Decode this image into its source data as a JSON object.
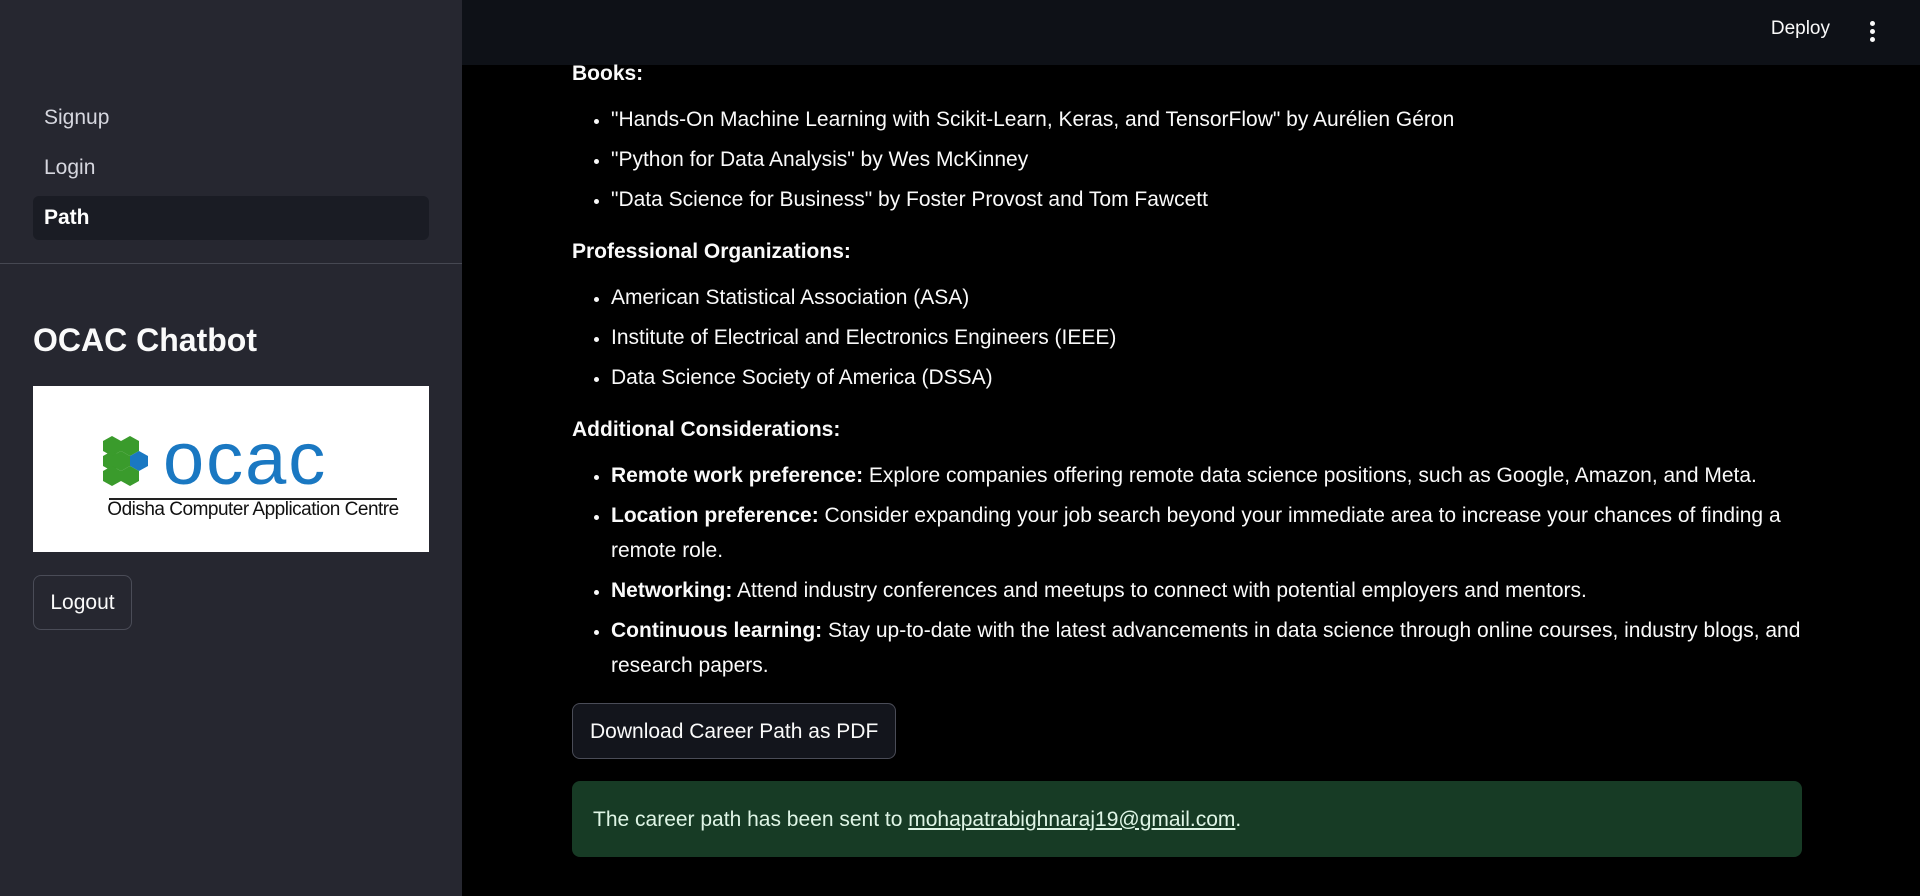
{
  "sidebar": {
    "nav": [
      {
        "label": "Signup",
        "active": false
      },
      {
        "label": "Login",
        "active": false
      },
      {
        "label": "Path",
        "active": true
      }
    ],
    "title": "OCAC Chatbot",
    "logo": {
      "wordmark": "ocac",
      "subtitle": "Odisha Computer Application Centre",
      "colors": {
        "green": "#3a9b2c",
        "blue": "#1a78c2"
      }
    },
    "logout_label": "Logout"
  },
  "header": {
    "deploy_label": "Deploy",
    "menu_icon": "kebab-menu-icon"
  },
  "main": {
    "books": {
      "heading": "Books:",
      "items": [
        "\"Hands-On Machine Learning with Scikit-Learn, Keras, and TensorFlow\" by Aurélien Géron",
        "\"Python for Data Analysis\" by Wes McKinney",
        "\"Data Science for Business\" by Foster Provost and Tom Fawcett"
      ]
    },
    "organizations": {
      "heading": "Professional Organizations:",
      "items": [
        "American Statistical Association (ASA)",
        "Institute of Electrical and Electronics Engineers (IEEE)",
        "Data Science Society of America (DSSA)"
      ]
    },
    "considerations": {
      "heading": "Additional Considerations:",
      "items": [
        {
          "label": "Remote work preference:",
          "text": " Explore companies offering remote data science positions, such as Google, Amazon, and Meta."
        },
        {
          "label": "Location preference:",
          "text": " Consider expanding your job search beyond your immediate area to increase your chances of finding a remote role."
        },
        {
          "label": "Networking:",
          "text": " Attend industry conferences and meetups to connect with potential employers and mentors."
        },
        {
          "label": "Continuous learning:",
          "text": " Stay up-to-date with the latest advancements in data science through online courses, industry blogs, and research papers."
        }
      ]
    },
    "download_label": "Download Career Path as PDF",
    "success": {
      "prefix": "The career path has been sent to ",
      "email": "mohapatrabighnaraj19@gmail.com",
      "suffix": "."
    }
  },
  "colors": {
    "sidebar_bg": "#262730",
    "header_bg": "#0e1117",
    "main_bg": "#000000",
    "success_bg": "#173b25"
  }
}
